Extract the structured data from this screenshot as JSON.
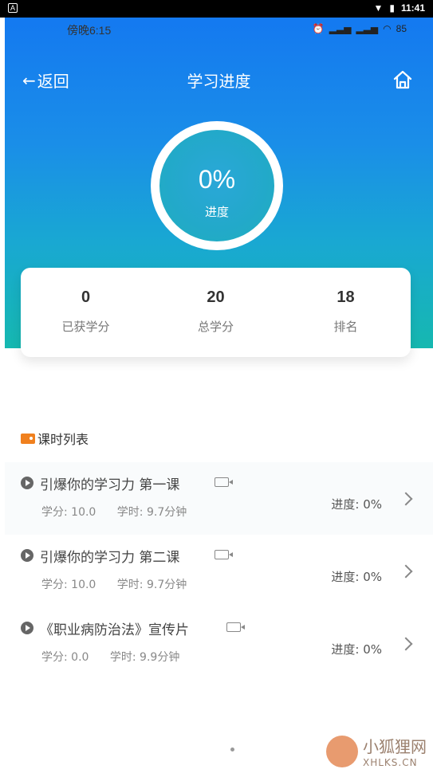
{
  "system_status": {
    "app_badge": "A",
    "clock": "11:41"
  },
  "inner_status": {
    "time": "傍晚6:15",
    "battery": "85"
  },
  "nav": {
    "back_label": "返回",
    "title": "学习进度"
  },
  "progress": {
    "percent_text": "0%",
    "label": "进度"
  },
  "stats": [
    {
      "value": "0",
      "label": "已获学分"
    },
    {
      "value": "20",
      "label": "总学分"
    },
    {
      "value": "18",
      "label": "排名"
    }
  ],
  "section": {
    "title": "课时列表"
  },
  "lessons": [
    {
      "name": "引爆你的学习力 第一课",
      "credit": "学分: 10.0",
      "hours": "学时: 9.7分钟",
      "progress": "进度: 0%"
    },
    {
      "name": "引爆你的学习力 第二课",
      "credit": "学分: 10.0",
      "hours": "学时: 9.7分钟",
      "progress": "进度: 0%"
    },
    {
      "name": "《职业病防治法》宣传片",
      "credit": "学分: 0.0",
      "hours": "学时: 9.9分钟",
      "progress": "进度: 0%"
    }
  ],
  "watermark": {
    "text_cn": "小狐狸网",
    "text_en": "XHLKS.CN"
  },
  "colors": {
    "gradient_top": "#1479f0",
    "gradient_bottom": "#16b8b0",
    "accent_tag": "#f0801e"
  }
}
